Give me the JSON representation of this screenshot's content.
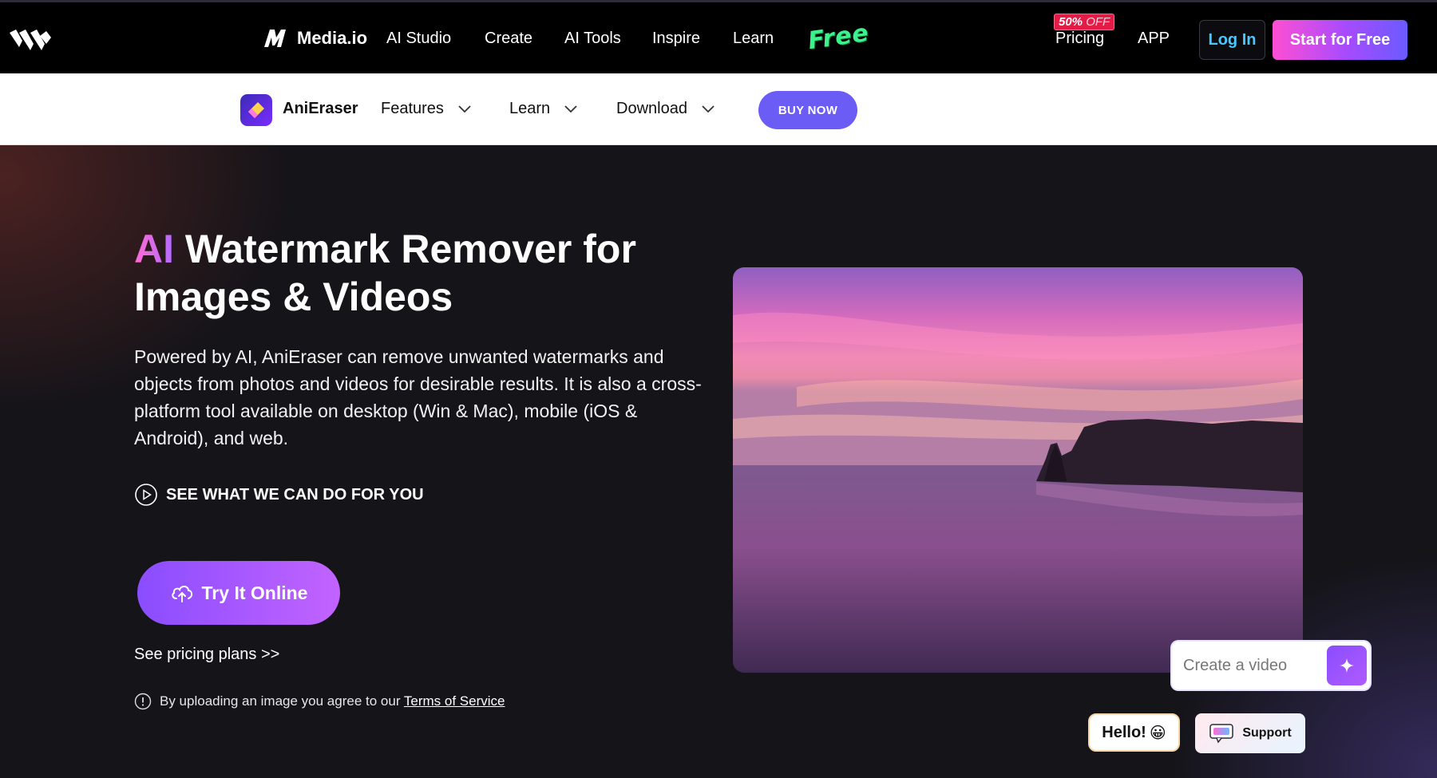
{
  "topnav": {
    "brand_name": "Media.io",
    "items": [
      "AI Studio",
      "Create",
      "AI Tools",
      "Inspire",
      "Learn"
    ],
    "free_tag": "Free",
    "sale_badge": {
      "percent": "50%",
      "off": "OFF"
    },
    "pricing": "Pricing",
    "app": "APP",
    "login": "Log In",
    "start_free": "Start for Free"
  },
  "subnav": {
    "product_name": "AniEraser",
    "dropdowns": [
      "Features",
      "Learn",
      "Download"
    ],
    "buy_now": "BUY NOW"
  },
  "hero": {
    "title_accent": "AI",
    "title_rest": " Watermark Remover for Images & Videos",
    "description": "Powered by AI, AniEraser can remove unwanted watermarks and objects from photos and videos for desirable results. It is also a cross-platform tool available on desktop (Win & Mac), mobile (iOS & Android), and web.",
    "see_what": "SEE WHAT WE CAN DO FOR YOU",
    "try_online": "Try It Online",
    "pricing_link": "See pricing plans >>",
    "terms_prefix": "By uploading an image you agree to our ",
    "terms_link": "Terms of Service"
  },
  "widgets": {
    "create_placeholder": "Create a video",
    "hello": "Hello!",
    "hello_emoji": "😀",
    "support": "Support"
  },
  "colors": {
    "accent_purple": "#6b5cf6",
    "login_blue": "#47c8ff",
    "free_green": "#3cf28b",
    "sale_red": "#e21b47"
  }
}
